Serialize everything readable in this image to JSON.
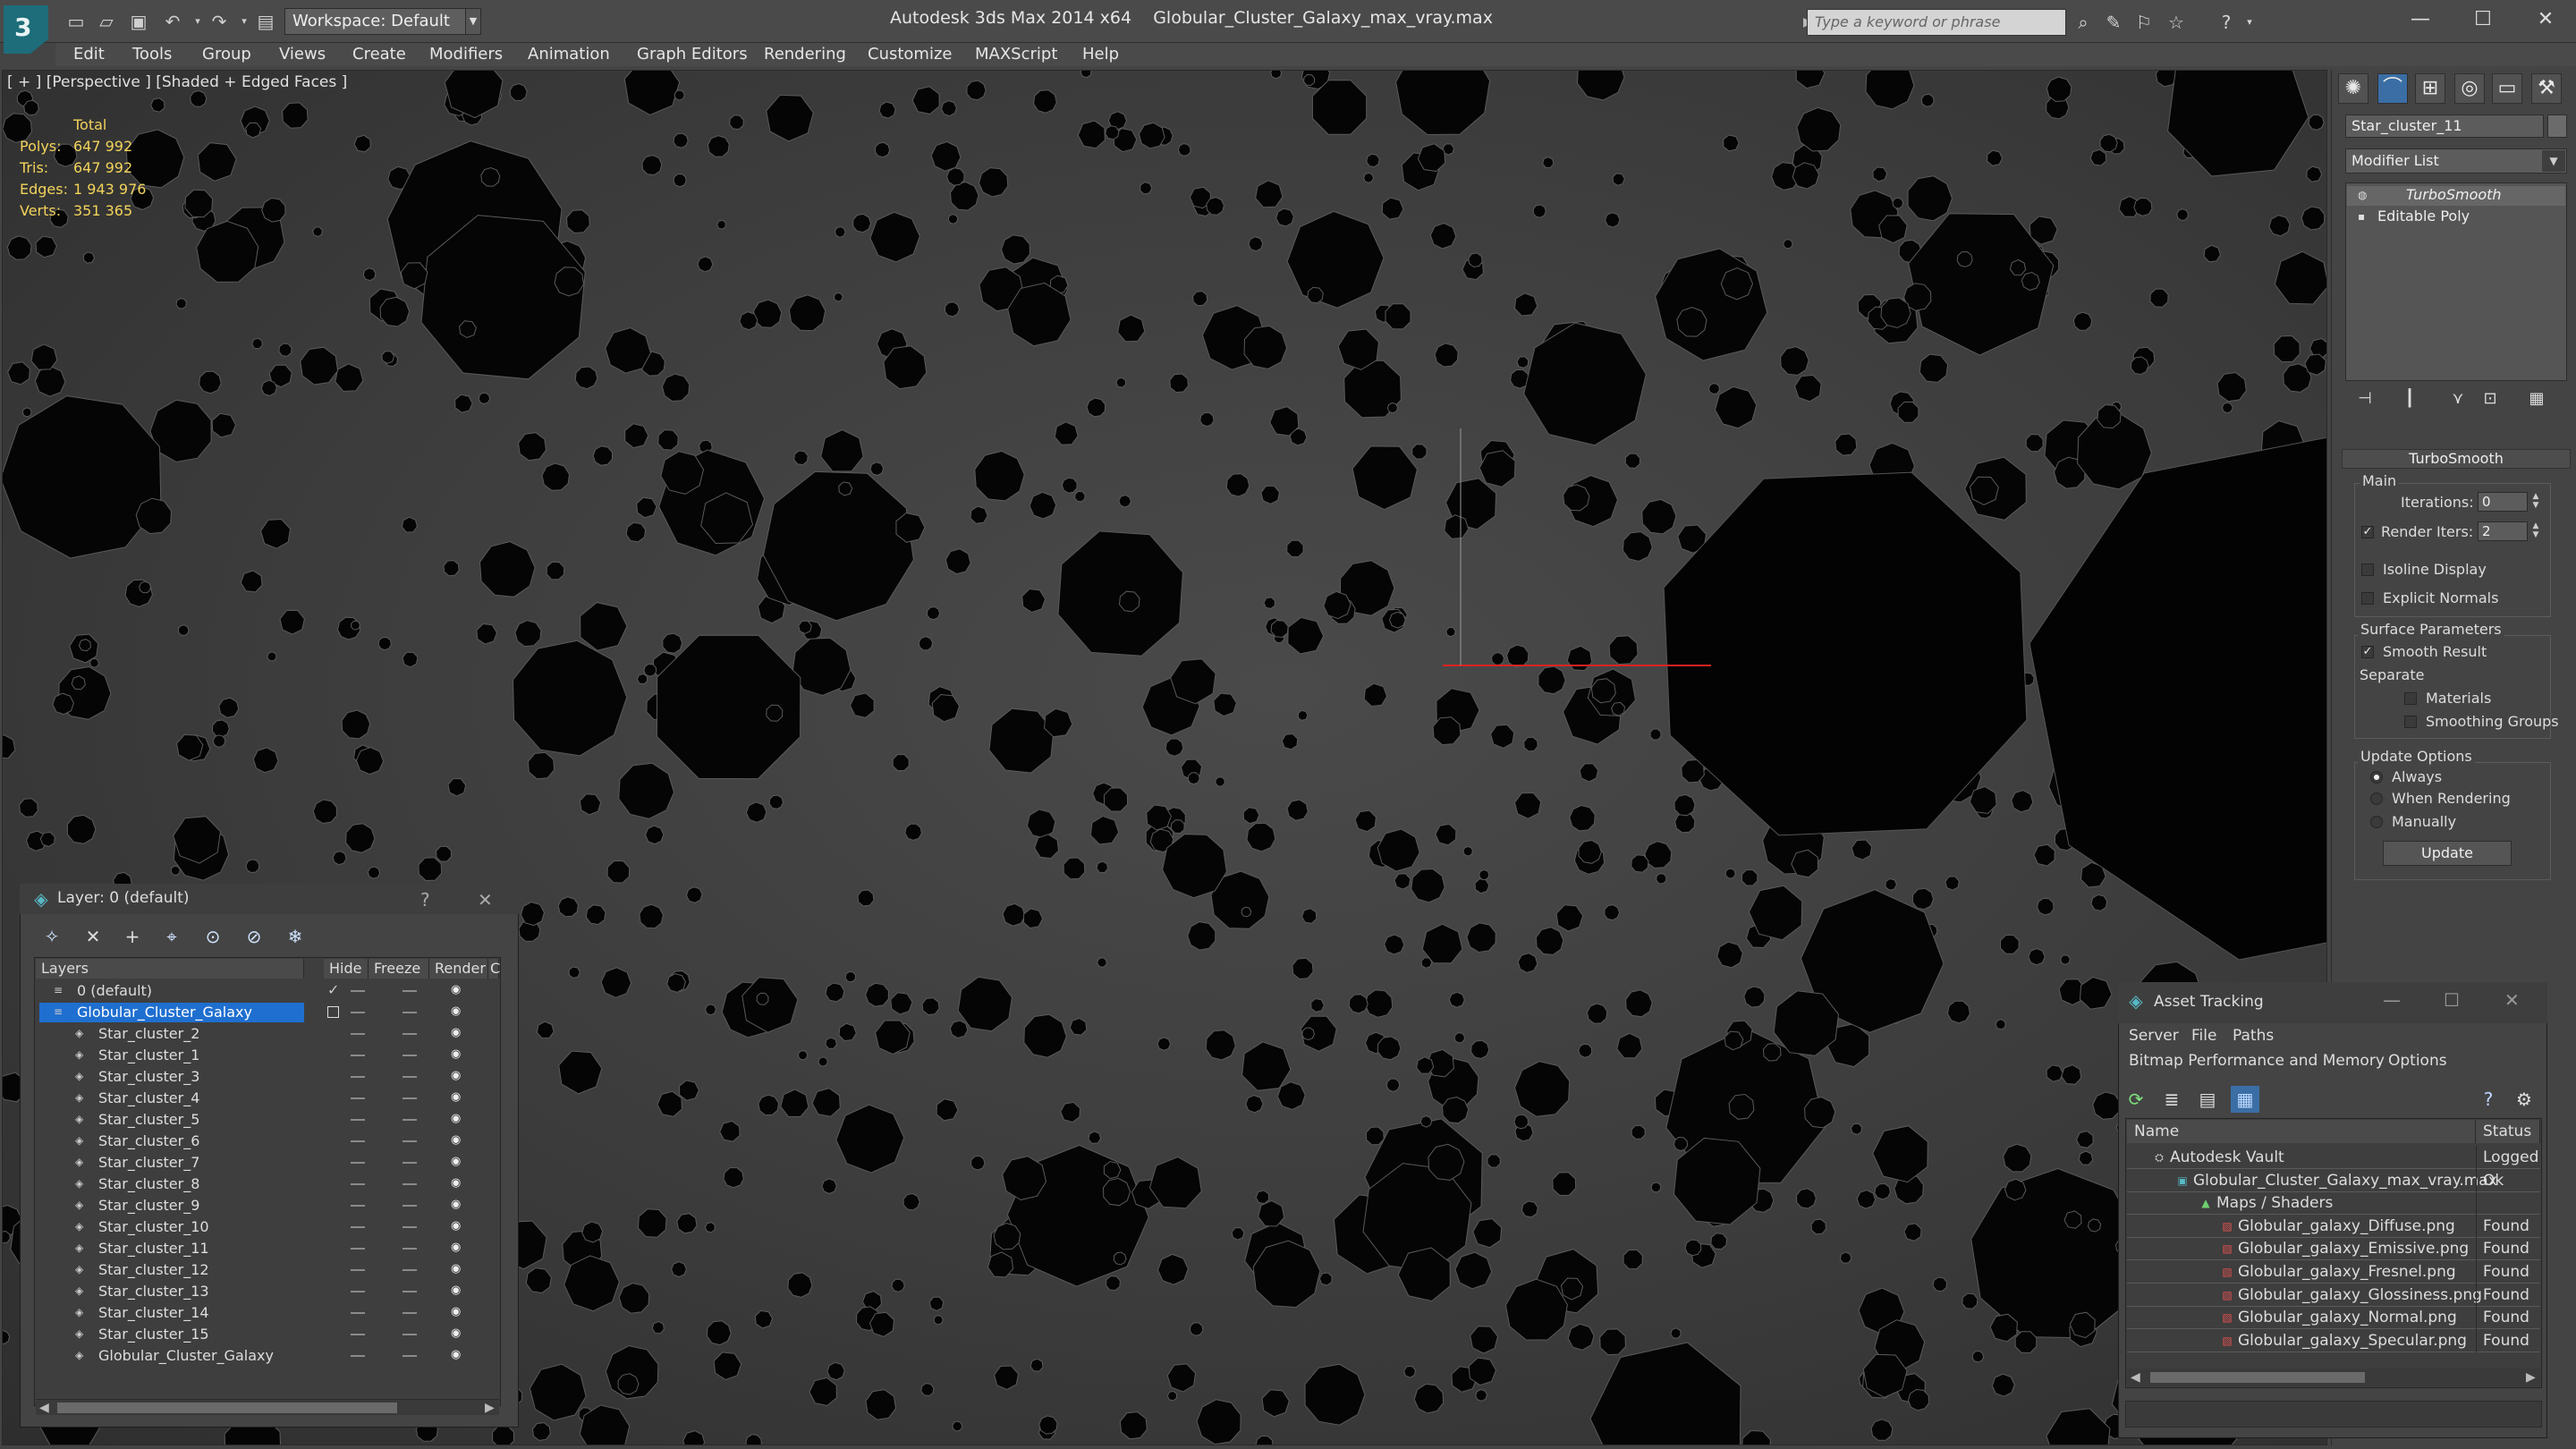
{
  "titlebar": {
    "workspace": "Workspace: Default",
    "app_title": "Autodesk 3ds Max  2014 x64",
    "file_name": "Globular_Cluster_Galaxy_max_vray.max",
    "search_placeholder": "Type a keyword or phrase"
  },
  "menu": [
    "Edit",
    "Tools",
    "Group",
    "Views",
    "Create",
    "Modifiers",
    "Animation",
    "Graph Editors",
    "Rendering",
    "Customize",
    "MAXScript",
    "Help"
  ],
  "viewport": {
    "label": "[ + ] [Perspective ] [Shaded + Edged Faces ]",
    "stats": {
      "total_label": "Total",
      "rows": [
        {
          "label": "Polys:",
          "value": "647 992"
        },
        {
          "label": "Tris:",
          "value": "647 992"
        },
        {
          "label": "Edges:",
          "value": "1 943 976"
        },
        {
          "label": "Verts:",
          "value": "351 365"
        }
      ]
    }
  },
  "command_panel": {
    "object_name": "Star_cluster_11",
    "modifier_list": "Modifier List",
    "stack": [
      "TurboSmooth",
      "Editable Poly"
    ],
    "rollout_title": "TurboSmooth",
    "main_label": "Main",
    "iterations_label": "Iterations:",
    "iterations_value": "0",
    "render_iters_label": "Render Iters:",
    "render_iters_value": "2",
    "isoline_display": "Isoline Display",
    "explicit_normals": "Explicit Normals",
    "surface_params": "Surface Parameters",
    "smooth_result": "Smooth Result",
    "separate": "Separate",
    "materials": "Materials",
    "smoothing_groups": "Smoothing Groups",
    "update_options": "Update Options",
    "always": "Always",
    "when_rendering": "When Rendering",
    "manually": "Manually",
    "update_button": "Update"
  },
  "layer_window": {
    "title": "Layer: 0 (default)",
    "help": "?",
    "close": "✕",
    "columns": [
      "Layers",
      "Hide",
      "Freeze",
      "Render",
      "C"
    ],
    "rows": [
      "0 (default)",
      "Globular_Cluster_Galaxy",
      "Star_cluster_2",
      "Star_cluster_1",
      "Star_cluster_3",
      "Star_cluster_4",
      "Star_cluster_5",
      "Star_cluster_6",
      "Star_cluster_7",
      "Star_cluster_8",
      "Star_cluster_9",
      "Star_cluster_10",
      "Star_cluster_11",
      "Star_cluster_12",
      "Star_cluster_13",
      "Star_cluster_14",
      "Star_cluster_15",
      "Globular_Cluster_Galaxy"
    ],
    "selected_row": "Globular_Cluster_Galaxy"
  },
  "asset_tracking": {
    "title": "Asset Tracking",
    "menu": [
      "Server",
      "File",
      "Paths"
    ],
    "menu2": [
      "Bitmap Performance and Memory",
      "Options"
    ],
    "columns": [
      "Name",
      "Status"
    ],
    "rows": [
      {
        "name": "Autodesk Vault",
        "status": "Logged"
      },
      {
        "name": "Globular_Cluster_Galaxy_max_vray.max",
        "status": "Ok"
      },
      {
        "name": "Maps / Shaders",
        "status": ""
      },
      {
        "name": "Globular_galaxy_Diffuse.png",
        "status": "Found"
      },
      {
        "name": "Globular_galaxy_Emissive.png",
        "status": "Found"
      },
      {
        "name": "Globular_galaxy_Fresnel.png",
        "status": "Found"
      },
      {
        "name": "Globular_galaxy_Glossiness.png",
        "status": "Found"
      },
      {
        "name": "Globular_galaxy_Normal.png",
        "status": "Found"
      },
      {
        "name": "Globular_galaxy_Specular.png",
        "status": "Found"
      }
    ]
  }
}
